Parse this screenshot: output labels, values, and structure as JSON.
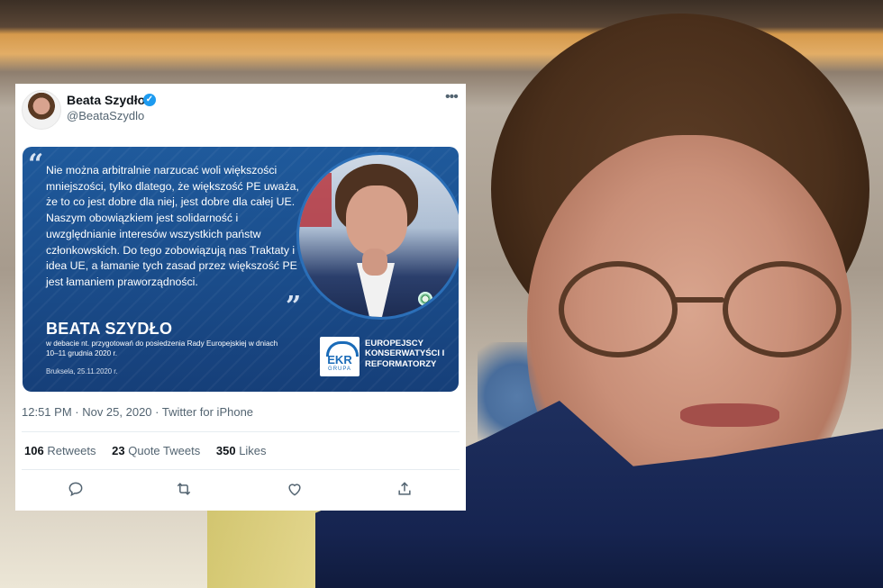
{
  "tweet": {
    "author_name": "Beata Szydło",
    "handle": "@BeataSzydlo",
    "verified_glyph": "✓",
    "more_glyph": "•••",
    "timestamp": "12:51 PM · Nov 25, 2020",
    "source": "Twitter for iPhone",
    "stats": {
      "retweets_count": "106",
      "retweets_label": "Retweets",
      "quotes_count": "23",
      "quotes_label": "Quote Tweets",
      "likes_count": "350",
      "likes_label": "Likes"
    },
    "actions": [
      "reply-icon",
      "retweet-icon",
      "like-icon",
      "share-icon"
    ]
  },
  "graphic": {
    "quote_open": "“",
    "quote_close": "”",
    "quote_text": "Nie można arbitralnie narzucać woli większości mniejszości, tylko dlatego, że większość PE uważa, że to co jest dobre dla niej, jest dobre dla całej UE. Naszym obowiązkiem jest solidarność i uwzględnianie interesów wszystkich państw członkowskich. Do tego zobowiązują nas Traktaty i idea UE, a łamanie tych zasad przez większość PE jest łamaniem praworządności.",
    "speaker": "BEATA SZYDŁO",
    "context": "w debacie nt. przygotowań do posiedzenia Rady Europejskiej w dniach 10–11 grudnia 2020 r.",
    "place_date": "Bruksela, 25.11.2020 r.",
    "logo_abbr": "EKR",
    "logo_grupa": "GRUPA",
    "group_name": "EUROPEJSCY KONSERWATYŚCI I REFORMATORZY"
  },
  "colors": {
    "graphic_blue": "#1a4c8a",
    "verified_blue": "#1d9bf0",
    "muted_text": "#536471"
  }
}
